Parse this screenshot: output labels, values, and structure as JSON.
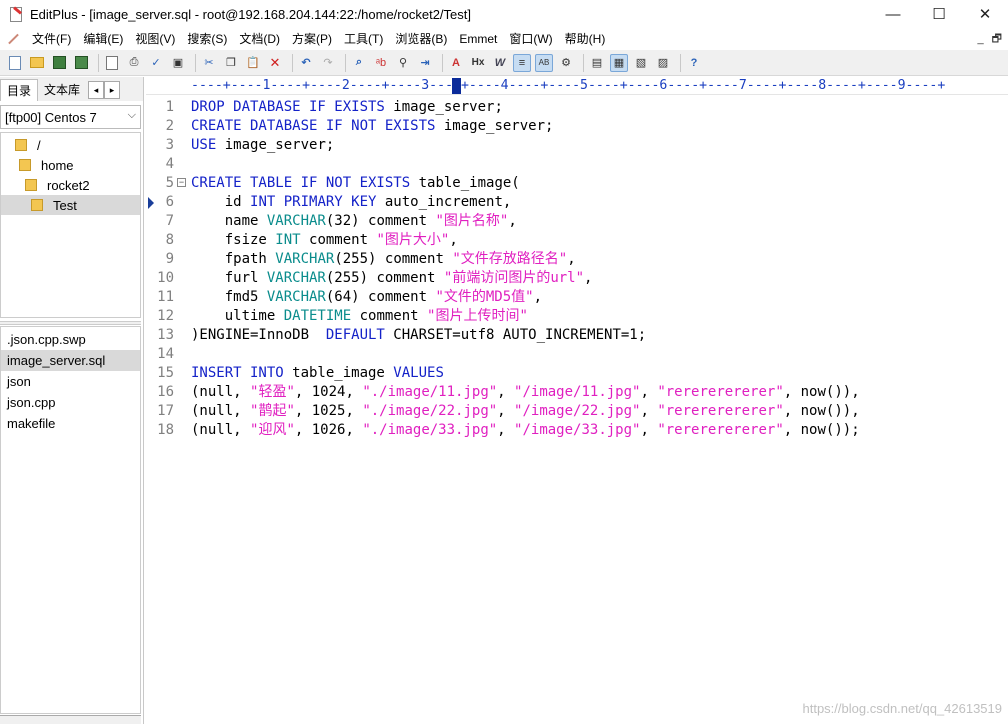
{
  "window": {
    "title": "EditPlus - [image_server.sql - root@192.168.204.144:22:/home/rocket2/Test]",
    "minimize": "—",
    "maximize": "☐",
    "close": "✕"
  },
  "menu": {
    "items": [
      "文件(F)",
      "编辑(E)",
      "视图(V)",
      "搜索(S)",
      "文档(D)",
      "方案(P)",
      "工具(T)",
      "浏览器(B)",
      "Emmet",
      "窗口(W)",
      "帮助(H)"
    ],
    "mdi_minimize": "_",
    "mdi_restore": "🗗"
  },
  "toolbar": {
    "icons": [
      "new-icon",
      "open-icon",
      "save-icon",
      "save-all-icon",
      "print-preview-icon",
      "print-icon",
      "spellcheck-icon",
      "browser-icon",
      "cut-icon",
      "copy-icon",
      "paste-icon",
      "delete-icon",
      "undo-icon",
      "redo-icon",
      "find-icon",
      "replace-icon",
      "find-in-files-icon",
      "goto-icon",
      "font-icon",
      "hx-icon",
      "word-wrap-icon",
      "line-numbers-icon",
      "ruler-icon",
      "settings-icon",
      "cliptext-icon",
      "directory-icon",
      "preview-icon",
      "browser-preview-icon",
      "help-icon"
    ]
  },
  "left_panel": {
    "tabs": [
      "目录",
      "文本库"
    ],
    "tab_prev": "◂",
    "tab_next": "▸",
    "drive": "[ftp00] Centos 7",
    "drive_chevron": "⌵",
    "tree": [
      {
        "label": "/",
        "indent": 0
      },
      {
        "label": "home",
        "indent": 1
      },
      {
        "label": "rocket2",
        "indent": 2
      },
      {
        "label": "Test",
        "indent": 3,
        "selected": true
      }
    ],
    "files": [
      {
        "name": ".json.cpp.swp"
      },
      {
        "name": "image_server.sql",
        "selected": true
      },
      {
        "name": "json"
      },
      {
        "name": "json.cpp"
      },
      {
        "name": "makefile"
      }
    ]
  },
  "editor": {
    "ruler": "----+----1----+----2----+----3----+----4----+----5----+----6----+----7----+----8----+----9----+",
    "lines": [
      {
        "n": "1",
        "tokens": [
          {
            "t": "DROP DATABASE IF EXISTS",
            "c": "kw"
          },
          {
            "t": " image_server;",
            "c": ""
          }
        ]
      },
      {
        "n": "2",
        "tokens": [
          {
            "t": "CREATE DATABASE IF NOT EXISTS",
            "c": "kw"
          },
          {
            "t": " image_server;",
            "c": ""
          }
        ]
      },
      {
        "n": "3",
        "tokens": [
          {
            "t": "USE",
            "c": "kw"
          },
          {
            "t": " image_server;",
            "c": ""
          }
        ]
      },
      {
        "n": "4",
        "tokens": []
      },
      {
        "n": "5",
        "fold": true,
        "tokens": [
          {
            "t": "CREATE TABLE IF NOT EXISTS",
            "c": "kw"
          },
          {
            "t": " table_image(",
            "c": ""
          }
        ]
      },
      {
        "n": "6",
        "bookmark": true,
        "tokens": [
          {
            "t": "    id ",
            "c": ""
          },
          {
            "t": "INT PRIMARY KEY",
            "c": "kw"
          },
          {
            "t": " auto_increment,",
            "c": ""
          }
        ]
      },
      {
        "n": "7",
        "tokens": [
          {
            "t": "    name ",
            "c": ""
          },
          {
            "t": "VARCHAR",
            "c": "ty"
          },
          {
            "t": "(32) comment ",
            "c": ""
          },
          {
            "t": "\"图片名称\"",
            "c": "st"
          },
          {
            "t": ",",
            "c": ""
          }
        ]
      },
      {
        "n": "8",
        "tokens": [
          {
            "t": "    fsize ",
            "c": ""
          },
          {
            "t": "INT",
            "c": "ty"
          },
          {
            "t": " comment ",
            "c": ""
          },
          {
            "t": "\"图片大小\"",
            "c": "st"
          },
          {
            "t": ",",
            "c": ""
          }
        ]
      },
      {
        "n": "9",
        "tokens": [
          {
            "t": "    fpath ",
            "c": ""
          },
          {
            "t": "VARCHAR",
            "c": "ty"
          },
          {
            "t": "(255) comment ",
            "c": ""
          },
          {
            "t": "\"文件存放路径名\"",
            "c": "st"
          },
          {
            "t": ",",
            "c": ""
          }
        ]
      },
      {
        "n": "10",
        "tokens": [
          {
            "t": "    furl ",
            "c": ""
          },
          {
            "t": "VARCHAR",
            "c": "ty"
          },
          {
            "t": "(255) comment ",
            "c": ""
          },
          {
            "t": "\"前端访问图片的url\"",
            "c": "st"
          },
          {
            "t": ",",
            "c": ""
          }
        ]
      },
      {
        "n": "11",
        "tokens": [
          {
            "t": "    fmd5 ",
            "c": ""
          },
          {
            "t": "VARCHAR",
            "c": "ty"
          },
          {
            "t": "(64) comment ",
            "c": ""
          },
          {
            "t": "\"文件的MD5值\"",
            "c": "st"
          },
          {
            "t": ",",
            "c": ""
          }
        ]
      },
      {
        "n": "12",
        "tokens": [
          {
            "t": "    ultime ",
            "c": ""
          },
          {
            "t": "DATETIME",
            "c": "ty"
          },
          {
            "t": " comment ",
            "c": ""
          },
          {
            "t": "\"图片上传时间\"",
            "c": "st"
          }
        ]
      },
      {
        "n": "13",
        "tokens": [
          {
            "t": ")ENGINE=InnoDB  ",
            "c": ""
          },
          {
            "t": "DEFAULT",
            "c": "kw"
          },
          {
            "t": " CHARSET=utf8 AUTO_INCREMENT=1;",
            "c": ""
          }
        ]
      },
      {
        "n": "14",
        "tokens": []
      },
      {
        "n": "15",
        "tokens": [
          {
            "t": "INSERT INTO",
            "c": "kw"
          },
          {
            "t": " table_image ",
            "c": ""
          },
          {
            "t": "VALUES",
            "c": "kw"
          }
        ]
      },
      {
        "n": "16",
        "tokens": [
          {
            "t": "(null, ",
            "c": ""
          },
          {
            "t": "\"轻盈\"",
            "c": "st"
          },
          {
            "t": ", 1024, ",
            "c": ""
          },
          {
            "t": "\"./image/11.jpg\"",
            "c": "st"
          },
          {
            "t": ", ",
            "c": ""
          },
          {
            "t": "\"/image/11.jpg\"",
            "c": "st"
          },
          {
            "t": ", ",
            "c": ""
          },
          {
            "t": "\"rerererererer\"",
            "c": "st"
          },
          {
            "t": ", now()),",
            "c": ""
          }
        ]
      },
      {
        "n": "17",
        "tokens": [
          {
            "t": "(null, ",
            "c": ""
          },
          {
            "t": "\"鹊起\"",
            "c": "st"
          },
          {
            "t": ", 1025, ",
            "c": ""
          },
          {
            "t": "\"./image/22.jpg\"",
            "c": "st"
          },
          {
            "t": ", ",
            "c": ""
          },
          {
            "t": "\"/image/22.jpg\"",
            "c": "st"
          },
          {
            "t": ", ",
            "c": ""
          },
          {
            "t": "\"rerererererer\"",
            "c": "st"
          },
          {
            "t": ", now()),",
            "c": ""
          }
        ]
      },
      {
        "n": "18",
        "tokens": [
          {
            "t": "(null, ",
            "c": ""
          },
          {
            "t": "\"迎风\"",
            "c": "st"
          },
          {
            "t": ", 1026, ",
            "c": ""
          },
          {
            "t": "\"./image/33.jpg\"",
            "c": "st"
          },
          {
            "t": ", ",
            "c": ""
          },
          {
            "t": "\"/image/33.jpg\"",
            "c": "st"
          },
          {
            "t": ", ",
            "c": ""
          },
          {
            "t": "\"rerererererer\"",
            "c": "st"
          },
          {
            "t": ", now());",
            "c": ""
          }
        ]
      }
    ]
  },
  "watermark": "https://blog.csdn.net/qq_42613519"
}
